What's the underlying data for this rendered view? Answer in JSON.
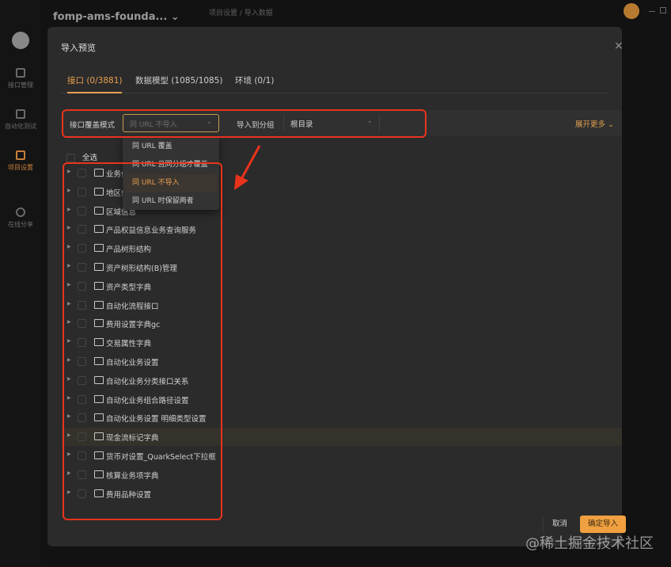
{
  "app": {
    "project": "fomp-ams-founda... ⌄",
    "breadcrumb": "项目设置 / 导入数据"
  },
  "sidebar": {
    "items": [
      {
        "label": "接口管理"
      },
      {
        "label": "自动化测试"
      },
      {
        "label": "项目设置",
        "active": true
      },
      {
        "label": "在线分享"
      }
    ]
  },
  "modal": {
    "title": "导入预览",
    "close": "×",
    "tabs": [
      {
        "label": "接口 (0/3881)"
      },
      {
        "label": "数据模型 (1085/1085)"
      },
      {
        "label": "环境 (0/1)"
      }
    ],
    "filter": {
      "mode_label": "接口覆盖模式",
      "mode_value": "同 URL 不导入",
      "group_label": "导入到分组",
      "group_value": "根目录",
      "expand": "展开更多"
    },
    "dropdown": [
      "同 URL 覆盖",
      "同 URL 且同分组才覆盖",
      "同 URL 不导入",
      "同 URL 时保留两者"
    ],
    "select_all": "全选",
    "tree": [
      "业务信息",
      "地区信息",
      "区域信息",
      "产品权益信息业务查询服务",
      "产品树形结构",
      "资产树形结构(B)管理",
      "资产类型字典",
      "自动化流程接口",
      "费用设置字典gc",
      "交易属性字典",
      "自动化业务设置",
      "自动化业务分类接口关系",
      "自动化业务组合路径设置",
      "自动化业务设置 明细类型设置",
      "现金流标记字典",
      "货币对设置_QuarkSelect下拉框",
      "核算业务项字典",
      "费用品种设置"
    ],
    "cancel": "取消",
    "confirm": "确定导入"
  },
  "watermark": "@稀土掘金技术社区",
  "colors": {
    "accent": "#e8a050",
    "annotation": "#e8331c"
  }
}
